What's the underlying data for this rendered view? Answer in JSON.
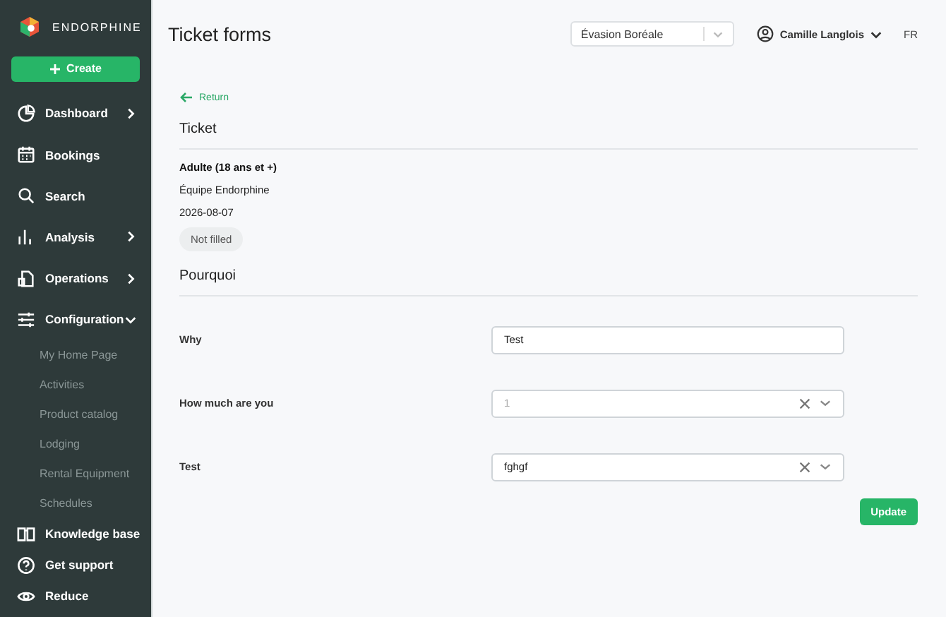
{
  "sidebar": {
    "brand": "ENDORPHINE",
    "create_button": "Create",
    "items": [
      {
        "label": "Dashboard",
        "expanded": false
      },
      {
        "label": "Bookings"
      },
      {
        "label": "Search"
      },
      {
        "label": "Analysis",
        "expanded": false
      },
      {
        "label": "Operations",
        "expanded": false
      },
      {
        "label": "Configuration",
        "expanded": true,
        "children": [
          "My Home Page",
          "Activities",
          "Product catalog",
          "Lodging",
          "Rental Equipment",
          "Schedules"
        ]
      }
    ],
    "footer": [
      {
        "label": "Knowledge base"
      },
      {
        "label": "Get support"
      },
      {
        "label": "Reduce"
      }
    ]
  },
  "header": {
    "title": "Ticket forms",
    "organization": "Évasion Boréale",
    "user": "Camille Langlois",
    "language": "FR"
  },
  "return_link": "Return",
  "ticket": {
    "heading": "Ticket",
    "name": "Adulte (18 ans et +)",
    "team": "Équipe Endorphine",
    "date": "2026-08-07",
    "status": "Not filled"
  },
  "form": {
    "heading": "Pourquoi",
    "fields": [
      {
        "label": "Why",
        "kind": "text",
        "value": "Test"
      },
      {
        "label": "How much are you",
        "kind": "select",
        "placeholder": "1"
      },
      {
        "label": "Test",
        "kind": "select",
        "value": "fghgf"
      }
    ],
    "submit": "Update"
  }
}
